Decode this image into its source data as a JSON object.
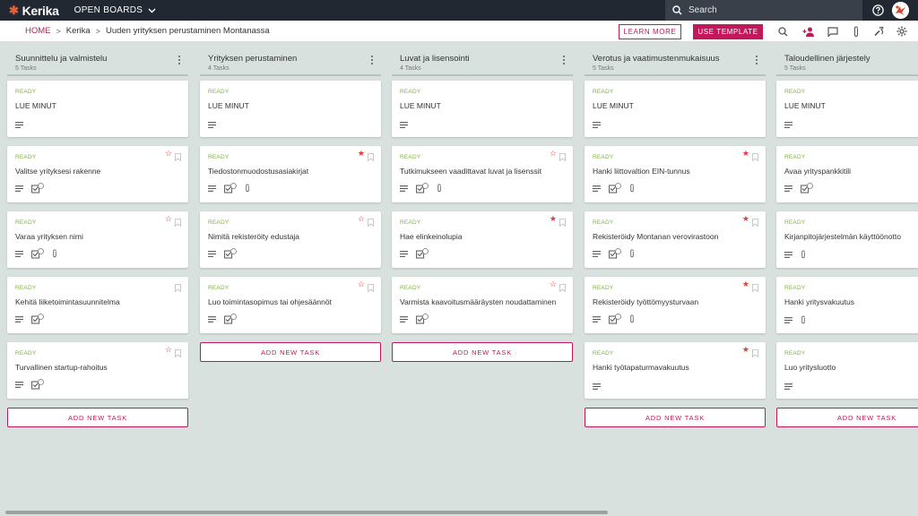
{
  "app": {
    "logo_text": "Kerika",
    "open_boards": "OPEN BOARDS"
  },
  "search": {
    "placeholder": "Search"
  },
  "breadcrumb": {
    "home": "HOME",
    "org": "Kerika",
    "board": "Uuden yrityksen perustaminen Montanassa"
  },
  "actions": {
    "learn_more": "LEARN MORE",
    "use_template": "USE TEMPLATE"
  },
  "colors": {
    "accent": "#c2185b",
    "ready": "#7cb342",
    "topbar": "#222831",
    "board_bg": "#d8e1dd"
  },
  "toolbar_icons": [
    "search-icon",
    "add-person-icon",
    "chat-icon",
    "attachment-icon",
    "tools-icon",
    "settings-icon"
  ],
  "add_task_label": "ADD NEW TASK",
  "columns": [
    {
      "title": "Suunnittelu ja valmistelu",
      "count": "5 Tasks",
      "cards": [
        {
          "status": "READY",
          "title": "LUE MINUT",
          "star": "none",
          "checks": "",
          "attach": false,
          "desc": true
        },
        {
          "status": "READY",
          "title": "Valitse yrityksesi rakenne",
          "star": "outline",
          "checks": "4",
          "attach": false,
          "desc": true
        },
        {
          "status": "READY",
          "title": "Varaa yrityksen nimi",
          "star": "outline",
          "checks": "4",
          "attach": true,
          "desc": true
        },
        {
          "status": "READY",
          "title": "Kehitä liiketoimintasuunnitelma",
          "star": "bookmark",
          "checks": "4",
          "attach": false,
          "desc": true
        },
        {
          "status": "READY",
          "title": "Turvallinen startup-rahoitus",
          "star": "outline",
          "checks": "4",
          "attach": false,
          "desc": true
        }
      ]
    },
    {
      "title": "Yrityksen perustaminen",
      "count": "4 Tasks",
      "cards": [
        {
          "status": "READY",
          "title": "LUE MINUT",
          "star": "none",
          "checks": "",
          "attach": false,
          "desc": true
        },
        {
          "status": "READY",
          "title": "Tiedostonmuodostusasiakirjat",
          "star": "filled",
          "checks": "4",
          "attach": true,
          "desc": true
        },
        {
          "status": "READY",
          "title": "Nimitä rekisteröity edustaja",
          "star": "outline",
          "checks": "3",
          "attach": false,
          "desc": true
        },
        {
          "status": "READY",
          "title": "Luo toimintasopimus tai ohjesäännöt",
          "star": "outline",
          "checks": "3",
          "attach": false,
          "desc": true
        }
      ]
    },
    {
      "title": "Luvat ja lisensointi",
      "count": "4 Tasks",
      "cards": [
        {
          "status": "READY",
          "title": "LUE MINUT",
          "star": "none",
          "checks": "",
          "attach": false,
          "desc": true
        },
        {
          "status": "READY",
          "title": "Tutkimukseen vaadittavat luvat ja lisenssit",
          "star": "outline",
          "checks": "3",
          "attach": true,
          "desc": true
        },
        {
          "status": "READY",
          "title": "Hae elinkeinolupia",
          "star": "filled",
          "checks": "3",
          "attach": false,
          "desc": true
        },
        {
          "status": "READY",
          "title": "Varmista kaavoitusmääräysten noudattaminen",
          "star": "outline",
          "checks": "3",
          "attach": false,
          "desc": true
        }
      ]
    },
    {
      "title": "Verotus ja vaatimustenmukaisuus",
      "count": "5 Tasks",
      "cards": [
        {
          "status": "READY",
          "title": "LUE MINUT",
          "star": "none",
          "checks": "",
          "attach": false,
          "desc": true
        },
        {
          "status": "READY",
          "title": "Hanki liittovaltion EIN-tunnus",
          "star": "filled",
          "checks": "3",
          "attach": true,
          "desc": true
        },
        {
          "status": "READY",
          "title": "Rekisteröidy Montanan verovirastoon",
          "star": "filled",
          "checks": "3",
          "attach": true,
          "desc": true
        },
        {
          "status": "READY",
          "title": "Rekisteröidy työttömyysturvaan",
          "star": "filled",
          "checks": "3",
          "attach": true,
          "desc": true
        },
        {
          "status": "READY",
          "title": "Hanki työtapaturmavakuutus",
          "star": "filled",
          "checks": "",
          "attach": false,
          "desc": true
        }
      ]
    },
    {
      "title": "Taloudellinen järjestely",
      "count": "5 Tasks",
      "cards": [
        {
          "status": "READY",
          "title": "LUE MINUT",
          "star": "none",
          "checks": "",
          "attach": false,
          "desc": true
        },
        {
          "status": "READY",
          "title": "Avaa yrityspankkitili",
          "star": "none",
          "checks": "4",
          "attach": false,
          "desc": true
        },
        {
          "status": "READY",
          "title": "Kirjanpitojärjestelmän käyttöönotto",
          "star": "none",
          "checks": "",
          "attach": true,
          "desc": true
        },
        {
          "status": "READY",
          "title": "Hanki yritysvakuutus",
          "star": "none",
          "checks": "",
          "attach": true,
          "desc": true
        },
        {
          "status": "READY",
          "title": "Luo yritysluotto",
          "star": "none",
          "checks": "",
          "attach": false,
          "desc": true
        }
      ]
    }
  ]
}
